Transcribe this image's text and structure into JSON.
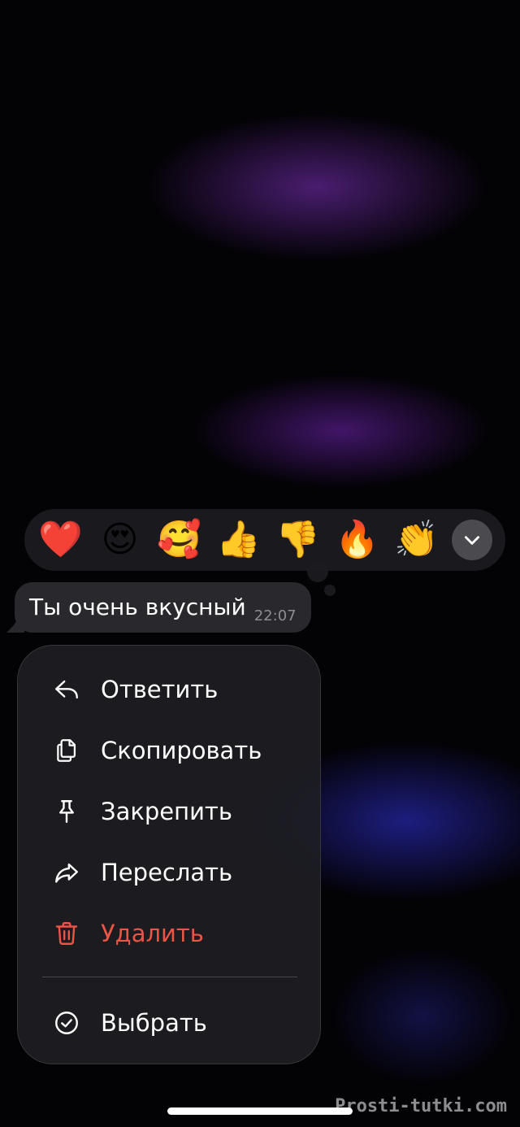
{
  "reactions": {
    "emojis": [
      {
        "glyph": "❤️",
        "name": "red-heart"
      },
      {
        "glyph": "😍",
        "name": "heart-eyes"
      },
      {
        "glyph": "🥰",
        "name": "smiling-face-with-hearts"
      },
      {
        "glyph": "👍",
        "name": "thumbs-up"
      },
      {
        "glyph": "👎",
        "name": "thumbs-down"
      },
      {
        "glyph": "🔥",
        "name": "fire"
      },
      {
        "glyph": "👏",
        "name": "clapping-hands"
      }
    ],
    "expand_icon": "chevron-down-icon"
  },
  "message": {
    "text": "Ты очень вкусный",
    "time": "22:07"
  },
  "menu": {
    "items": [
      {
        "label": "Ответить",
        "icon": "reply-icon"
      },
      {
        "label": "Скопировать",
        "icon": "copy-icon"
      },
      {
        "label": "Закрепить",
        "icon": "pin-icon"
      },
      {
        "label": "Переслать",
        "icon": "forward-icon"
      },
      {
        "label": "Удалить",
        "icon": "trash-icon",
        "color": "#eb5545"
      },
      {
        "label": "Выбрать",
        "icon": "check-circle-icon"
      }
    ]
  },
  "watermark": "Prosti-tutki.com",
  "colors": {
    "danger": "#eb5545",
    "bubble": "#29282d",
    "menu_background": "#1e1e24"
  }
}
